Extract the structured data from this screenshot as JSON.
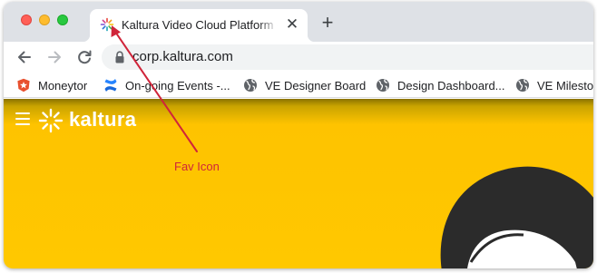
{
  "browser": {
    "tab": {
      "title": "Kaltura Video Cloud Platform -",
      "close_glyph": "✕"
    },
    "new_tab_glyph": "+",
    "url": "corp.kaltura.com"
  },
  "bookmarks": [
    {
      "label": "Moneytor",
      "icon": "moneytor-icon"
    },
    {
      "label": "On-going Events -...",
      "icon": "confluence-icon"
    },
    {
      "label": "VE Designer Board",
      "icon": "globe-icon"
    },
    {
      "label": "Design Dashboard...",
      "icon": "globe-icon"
    },
    {
      "label": "VE Milestones",
      "icon": "globe-icon"
    }
  ],
  "site": {
    "logo_text": "kaltura",
    "background_color": "#ffc800"
  },
  "annotation": {
    "label": "Fav Icon",
    "color": "#d0253a"
  }
}
